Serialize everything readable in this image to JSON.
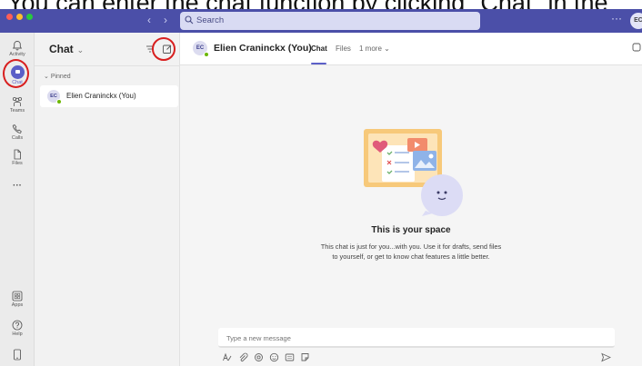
{
  "caption": "You can enter the chat function by clicking \"Chat\" in the",
  "titlebar": {
    "search_placeholder": "Search",
    "more_label": "···",
    "avatar_initials": "EC",
    "accent": "#4b4fa8"
  },
  "rail": {
    "items": [
      {
        "label": "Activity",
        "icon": "bell-icon"
      },
      {
        "label": "Chat",
        "icon": "chat-icon"
      },
      {
        "label": "Teams",
        "icon": "teams-icon"
      },
      {
        "label": "Calls",
        "icon": "phone-icon"
      },
      {
        "label": "Files",
        "icon": "file-icon"
      },
      {
        "label": "···",
        "icon": "more-icon"
      },
      {
        "label": "Apps",
        "icon": "apps-icon"
      },
      {
        "label": "Help",
        "icon": "help-icon"
      }
    ]
  },
  "chatlist": {
    "title": "Chat",
    "section": "Pinned",
    "contacts": [
      {
        "initials": "EC",
        "name": "Elien Craninckx (You)"
      }
    ]
  },
  "conversation": {
    "initials": "EC",
    "name": "Elien Craninckx (You)",
    "tabs": [
      "Chat",
      "Files",
      "1 more"
    ],
    "empty_title": "This is your space",
    "empty_desc_line1": "This chat is just for you...with you. Use it for drafts, send files",
    "empty_desc_line2": "to yourself, or get to know chat features a little better.",
    "composer_placeholder": "Type a new message"
  },
  "colors": {
    "brand": "#5b5fc7",
    "highlight_ring": "#d81f1f",
    "presence": "#6bb700"
  }
}
